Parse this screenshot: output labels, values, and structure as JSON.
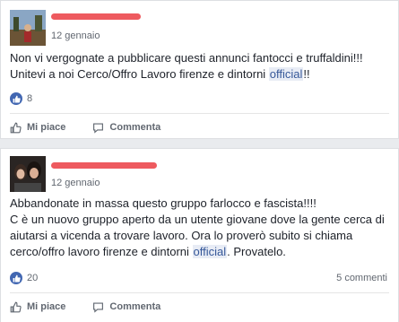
{
  "colors": {
    "brand_blue": "#4267b2",
    "redact_red": "#e8232a",
    "muted_text": "#616770",
    "link_blue": "#365899"
  },
  "icons": {
    "like_badge": "thumbs-up-icon",
    "like_action": "thumbs-up-outline-icon",
    "comment_action": "comment-icon"
  },
  "posts": [
    {
      "timestamp": "12 gennaio",
      "text_lines": [
        "Non vi vergognate a pubblicare questi annunci fantocci e truffaldini!!!",
        "Unitevi a noi Cerco/Offro Lavoro firenze e dintorni "
      ],
      "highlight": "official",
      "text_end": "!!",
      "like_count": "8",
      "comments": "",
      "actions": {
        "like": "Mi piace",
        "comment": "Commenta"
      }
    },
    {
      "timestamp": "12 gennaio",
      "text_first": "Abbandonate in massa questo gruppo farlocco e fascista!!!!",
      "text_body": "C è un nuovo gruppo aperto da un utente giovane dove la gente cerca di aiutarsi a vicenda a trovare lavoro. Ora lo proverò subito si chiama cerco/offro lavoro firenze e dintorni ",
      "highlight": "official",
      "text_end": ". Provatelo.",
      "like_count": "20",
      "comments": "5 commenti",
      "actions": {
        "like": "Mi piace",
        "comment": "Commenta"
      }
    }
  ]
}
